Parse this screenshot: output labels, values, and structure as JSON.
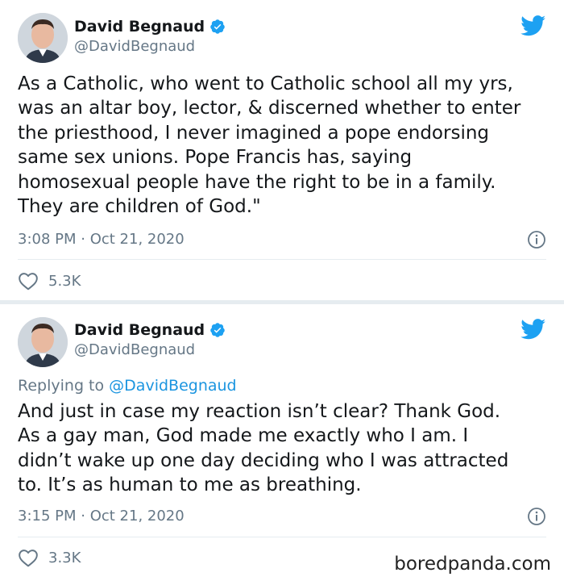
{
  "tweets": [
    {
      "author": {
        "name": "David Begnaud",
        "handle": "@DavidBegnaud",
        "verified": true
      },
      "reply_to": null,
      "text_lines": [
        "As a Catholic, who went to Catholic school all my yrs,",
        "was an altar boy, lector, & discerned whether to enter",
        "the priesthood, I never imagined a pope endorsing",
        "same sex unions. Pope Francis has, saying",
        "homosexual people have the right to be in a family.",
        "They are children of God.\""
      ],
      "timestamp": "3:08 PM · Oct 21, 2020",
      "likes": "5.3K"
    },
    {
      "author": {
        "name": "David Begnaud",
        "handle": "@DavidBegnaud",
        "verified": true
      },
      "reply_to": {
        "prefix": "Replying to",
        "mention": "@DavidBegnaud"
      },
      "text_lines": [
        "And just in case my reaction isn’t clear? Thank God.",
        "As a gay man, God made me exactly who I am. I",
        "didn’t wake up one day deciding who I was attracted",
        "to. It’s as human to me as breathing."
      ],
      "timestamp": "3:15 PM · Oct 21, 2020",
      "likes": "3.3K"
    }
  ],
  "watermark": "boredpanda.com",
  "colors": {
    "twitter_blue": "#1da1f2",
    "muted": "#657786",
    "text": "#14171a",
    "link": "#1b95e0"
  },
  "icons": [
    "twitter-bird-icon",
    "verified-badge-icon",
    "info-icon",
    "heart-icon"
  ]
}
